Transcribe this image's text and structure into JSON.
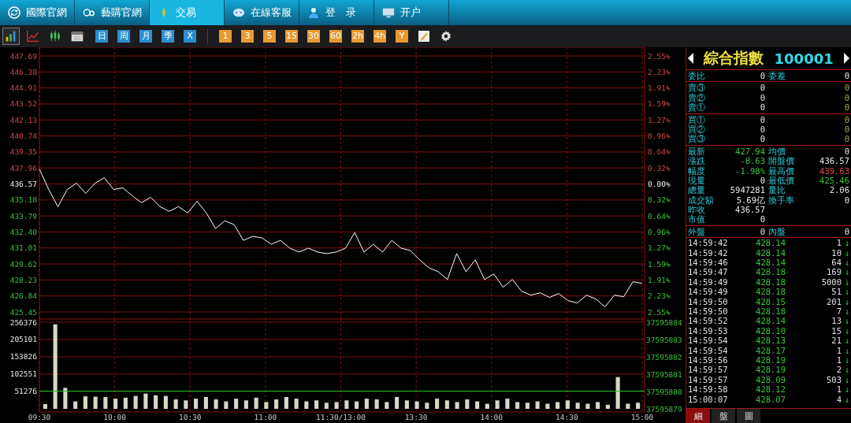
{
  "nav_tabs": [
    {
      "label": "國際官網",
      "kind": "globe",
      "selected": false
    },
    {
      "label": "藝購官網",
      "kind": "go",
      "selected": false
    },
    {
      "label": "交易",
      "kind": "leaf",
      "selected": true
    },
    {
      "label": "在線客服",
      "kind": "chat",
      "selected": false
    },
    {
      "label": "登　录",
      "kind": "person",
      "selected": false
    },
    {
      "label": "开户",
      "kind": "monitor",
      "selected": false
    }
  ],
  "toolbar": {
    "chart_types": [
      {
        "kind": "bars",
        "selected": true
      },
      {
        "kind": "line",
        "selected": false
      },
      {
        "kind": "candles",
        "selected": false
      },
      {
        "kind": "calendar",
        "selected": false
      }
    ],
    "periods": [
      "日",
      "周",
      "月",
      "季",
      "X"
    ],
    "intervals": [
      "1",
      "3",
      "5",
      "15",
      "30",
      "60",
      "2h",
      "4h",
      "Y"
    ]
  },
  "price_chart": {
    "chart_data": {
      "type": "line",
      "ylim": [
        425.45,
        447.69
      ],
      "grid": true,
      "yticks": [
        {
          "value": 447.69,
          "label": "447.69"
        },
        {
          "value": 446.3,
          "label": "446.30"
        },
        {
          "value": 444.91,
          "label": "444.91"
        },
        {
          "value": 443.52,
          "label": "443.52"
        },
        {
          "value": 442.13,
          "label": "442.13"
        },
        {
          "value": 440.74,
          "label": "440.74"
        },
        {
          "value": 439.35,
          "label": "439.35"
        },
        {
          "value": 437.96,
          "label": "437.96"
        },
        {
          "value": 436.57,
          "label": "436.57"
        },
        {
          "value": 435.18,
          "label": "435.18"
        },
        {
          "value": 433.79,
          "label": "433.79"
        },
        {
          "value": 432.4,
          "label": "432.40"
        },
        {
          "value": 431.01,
          "label": "431.01"
        },
        {
          "value": 429.62,
          "label": "429.62"
        },
        {
          "value": 428.23,
          "label": "428.23"
        },
        {
          "value": 426.84,
          "label": "426.84"
        },
        {
          "value": 425.45,
          "label": "425.45"
        }
      ],
      "series": [
        {
          "color": "#ffffff",
          "values": [
            437.86,
            436.09,
            434.59,
            436.09,
            436.64,
            435.75,
            436.64,
            437.11,
            436.09,
            436.23,
            435.55,
            434.94,
            435.41,
            434.6,
            434.19,
            434.6,
            434.05,
            435.07,
            434.05,
            432.69,
            433.37,
            433.03,
            431.67,
            432.01,
            431.88,
            431.33,
            431.67,
            430.99,
            430.65,
            430.99,
            430.65,
            430.52,
            430.65,
            430.99,
            432.35,
            430.65,
            431.33,
            430.65,
            431.67,
            430.99,
            430.79,
            429.97,
            429.29,
            428.95,
            428.27,
            430.52,
            428.95,
            429.97,
            428.27,
            428.75,
            427.59,
            428.27,
            427.25,
            426.91,
            427.11,
            426.71,
            427.05,
            426.43,
            426.23,
            426.91,
            426.57,
            425.89,
            426.91,
            426.77,
            428.07,
            427.94
          ]
        }
      ]
    },
    "right_axis_labels": [
      "2.55%",
      "2.23%",
      "1.91%",
      "1.59%",
      "1.27%",
      "0.96%",
      "0.64%",
      "0.32%",
      "0.00%",
      "0.32%",
      "0.64%",
      "0.96%",
      "1.27%",
      "1.59%",
      "1.91%",
      "2.23%",
      "2.55%"
    ]
  },
  "volume_chart": {
    "chart_data": {
      "type": "bar",
      "ylim": [
        0,
        256376
      ],
      "grid": true,
      "yticks": [
        51276,
        102551,
        153826,
        205101,
        256376
      ],
      "series": [
        {
          "color": "#d8d8c8",
          "values": [
            14000,
            250000,
            62000,
            22000,
            37000,
            36000,
            35000,
            30000,
            33000,
            38000,
            45000,
            40000,
            38000,
            28000,
            25000,
            30000,
            35000,
            28000,
            22000,
            30000,
            25000,
            33000,
            20000,
            28000,
            35000,
            30000,
            22000,
            25000,
            18000,
            20000,
            25000,
            22000,
            30000,
            28000,
            20000,
            35000,
            25000,
            22000,
            18000,
            30000,
            25000,
            20000,
            28000,
            22000,
            15000,
            25000,
            30000,
            20000,
            18000,
            22000,
            15000,
            20000,
            25000,
            18000,
            15000,
            20000,
            12000,
            94000,
            15000,
            18000
          ]
        }
      ]
    },
    "time_labels": [
      "09:30",
      "10:00",
      "10:30",
      "11:00",
      "11:30/13:00",
      "13:30",
      "14:00",
      "14:30",
      "15:00"
    ],
    "right_axis_labels": [
      "37595884",
      "37595883",
      "37595882",
      "37595881",
      "37595880",
      "37595879"
    ]
  },
  "quote": {
    "title": "綜合指數",
    "code": "100001",
    "ratio_row": {
      "label": "委比",
      "value": "0",
      "label2": "委差",
      "value2": "0"
    },
    "asks": [
      {
        "label": "賣③",
        "price": "0",
        "volume": "0"
      },
      {
        "label": "賣②",
        "price": "0",
        "volume": "0"
      },
      {
        "label": "賣①",
        "price": "0",
        "volume": "0"
      }
    ],
    "bids": [
      {
        "label": "買①",
        "price": "0",
        "volume": "0"
      },
      {
        "label": "買②",
        "price": "0",
        "volume": "0"
      },
      {
        "label": "買③",
        "price": "0",
        "volume": "0"
      }
    ],
    "stats": [
      {
        "left": {
          "label": "最新",
          "value": "427.94",
          "color": "#3cc23c"
        },
        "right": {
          "label": "均價",
          "value": "0"
        }
      },
      {
        "left": {
          "label": "漲跌",
          "value": "-8.63",
          "color": "#3cc23c"
        },
        "right": {
          "label": "開盤價",
          "value": "436.57"
        }
      },
      {
        "left": {
          "label": "幅度",
          "value": "-1.98%",
          "color": "#3cc23c"
        },
        "right": {
          "label": "最高價",
          "value": "439.63",
          "color": "#e04848"
        }
      },
      {
        "left": {
          "label": "現量",
          "value": "0"
        },
        "right": {
          "label": "最低價",
          "value": "425.46",
          "color": "#3cc23c"
        }
      },
      {
        "left": {
          "label": "總量",
          "value": "5947281"
        },
        "right": {
          "label": "量比",
          "value": "2.06"
        }
      },
      {
        "left": {
          "label": "成交額",
          "value": "5.69亿"
        },
        "right": {
          "label": "換手率",
          "value": "0"
        }
      },
      {
        "left": {
          "label": "昨收",
          "value": "436.57"
        }
      },
      {
        "left": {
          "label": "市值",
          "value": "0"
        }
      }
    ],
    "outer_inner": {
      "label": "外盤",
      "value": "0",
      "label2": "內盤",
      "value2": "0"
    },
    "trades": [
      {
        "time": "14:59:42",
        "price": "428.14",
        "volume": "1",
        "arrow": "↓"
      },
      {
        "time": "14:59:42",
        "price": "428.14",
        "volume": "10",
        "arrow": "↓"
      },
      {
        "time": "14:59:46",
        "price": "428.14",
        "volume": "64",
        "arrow": "↓"
      },
      {
        "time": "14:59:47",
        "price": "428.18",
        "volume": "169",
        "arrow": "↓"
      },
      {
        "time": "14:59:49",
        "price": "428.18",
        "volume": "5000",
        "arrow": "↓"
      },
      {
        "time": "14:59:49",
        "price": "428.18",
        "volume": "51",
        "arrow": "↓"
      },
      {
        "time": "14:59:50",
        "price": "428.15",
        "volume": "201",
        "arrow": "↓"
      },
      {
        "time": "14:59:50",
        "price": "428.18",
        "volume": "7",
        "arrow": "↓"
      },
      {
        "time": "14:59:52",
        "price": "428.14",
        "volume": "13",
        "arrow": "↓"
      },
      {
        "time": "14:59:53",
        "price": "428.10",
        "volume": "15",
        "arrow": "↓"
      },
      {
        "time": "14:59:54",
        "price": "428.13",
        "volume": "21",
        "arrow": "↓"
      },
      {
        "time": "14:59:54",
        "price": "428.17",
        "volume": "1",
        "arrow": "↓"
      },
      {
        "time": "14:59:56",
        "price": "428.19",
        "volume": "1",
        "arrow": "↓"
      },
      {
        "time": "14:59:57",
        "price": "428.19",
        "volume": "2",
        "arrow": "↓"
      },
      {
        "time": "14:59:57",
        "price": "428.09",
        "volume": "503",
        "arrow": "↓"
      },
      {
        "time": "14:59:58",
        "price": "428.12",
        "volume": "1",
        "arrow": "↓"
      },
      {
        "time": "15:00:07",
        "price": "428.07",
        "volume": "4",
        "arrow": "↓"
      }
    ],
    "tabs": [
      {
        "label": "細",
        "selected": true
      },
      {
        "label": "盤",
        "selected": false
      },
      {
        "label": "圖",
        "selected": false
      }
    ]
  }
}
